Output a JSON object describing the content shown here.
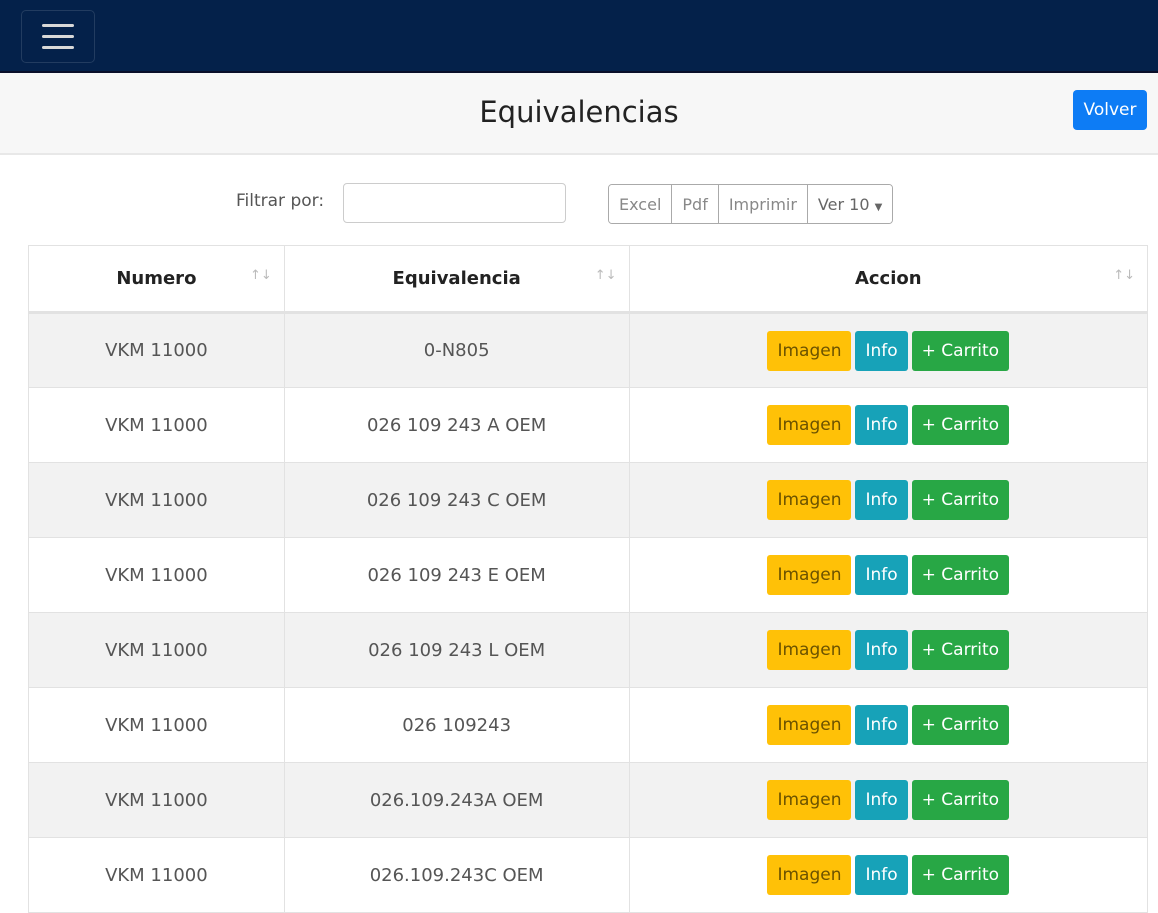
{
  "nav": {
    "menu_icon": "hamburger-icon"
  },
  "header": {
    "title": "Equivalencias",
    "back_label": "Volver"
  },
  "filter": {
    "label": "Filtrar por:",
    "value": "",
    "export_buttons": [
      "Excel",
      "Pdf",
      "Imprimir"
    ],
    "page_size": "Ver 10"
  },
  "table": {
    "columns": [
      "Numero",
      "Equivalencia",
      "Accion"
    ],
    "action_labels": {
      "image": "Imagen",
      "info": "Info",
      "cart": "+ Carrito"
    },
    "rows": [
      {
        "numero": "VKM 11000",
        "equivalencia": "0-N805"
      },
      {
        "numero": "VKM 11000",
        "equivalencia": "026 109 243 A OEM"
      },
      {
        "numero": "VKM 11000",
        "equivalencia": "026 109 243 C OEM"
      },
      {
        "numero": "VKM 11000",
        "equivalencia": "026 109 243 E OEM"
      },
      {
        "numero": "VKM 11000",
        "equivalencia": "026 109 243 L OEM"
      },
      {
        "numero": "VKM 11000",
        "equivalencia": "026 109243"
      },
      {
        "numero": "VKM 11000",
        "equivalencia": "026.109.243A OEM"
      },
      {
        "numero": "VKM 11000",
        "equivalencia": "026.109.243C OEM"
      }
    ]
  }
}
